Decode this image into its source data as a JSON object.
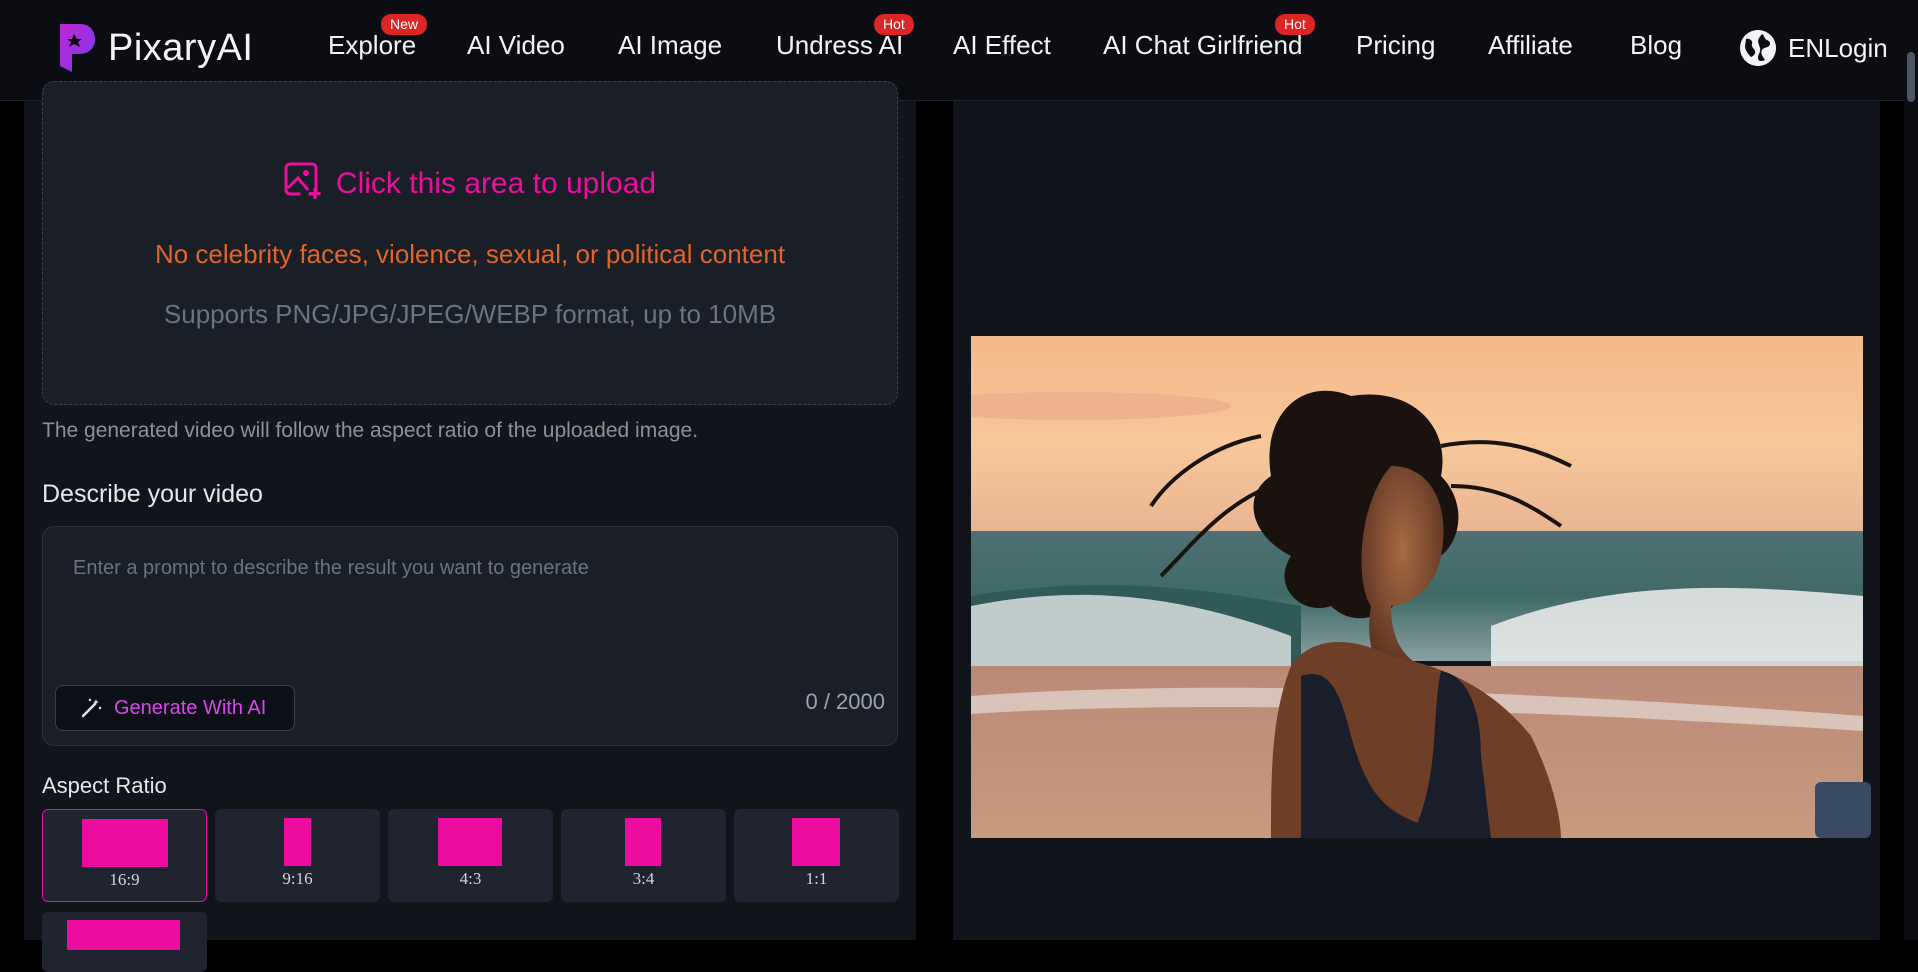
{
  "nav": {
    "logo_text": "PixaryAI",
    "items": [
      {
        "label": "Explore",
        "badge": "New"
      },
      {
        "label": "AI Video",
        "badge": ""
      },
      {
        "label": "AI Image",
        "badge": ""
      },
      {
        "label": "Undress AI",
        "badge": "Hot"
      },
      {
        "label": "AI Effect",
        "badge": ""
      },
      {
        "label": "AI Chat Girlfriend",
        "badge": "Hot"
      },
      {
        "label": "Pricing",
        "badge": ""
      },
      {
        "label": "Affiliate",
        "badge": ""
      },
      {
        "label": "Blog",
        "badge": ""
      }
    ],
    "lang": "EN",
    "login": "Login"
  },
  "upload": {
    "title": "Click this area to upload",
    "warning": "No celebrity faces, violence, sexual, or political content",
    "formats": "Supports PNG/JPG/JPEG/WEBP format, up to 10MB",
    "note": "The generated video will follow the aspect ratio of the uploaded image."
  },
  "prompt": {
    "title": "Describe your video",
    "placeholder": "Enter a prompt to describe the result you want to generate",
    "generate_label": "Generate With AI",
    "counter": "0 / 2000"
  },
  "aspect_ratio": {
    "title": "Aspect Ratio",
    "options": [
      "16:9",
      "9:16",
      "4:3",
      "3:4",
      "1:1"
    ],
    "selected": "16:9"
  },
  "colors": {
    "accent": "#ec0c9f",
    "warning": "#e0652a",
    "badge": "#dc2626",
    "panel": "#11141b"
  }
}
